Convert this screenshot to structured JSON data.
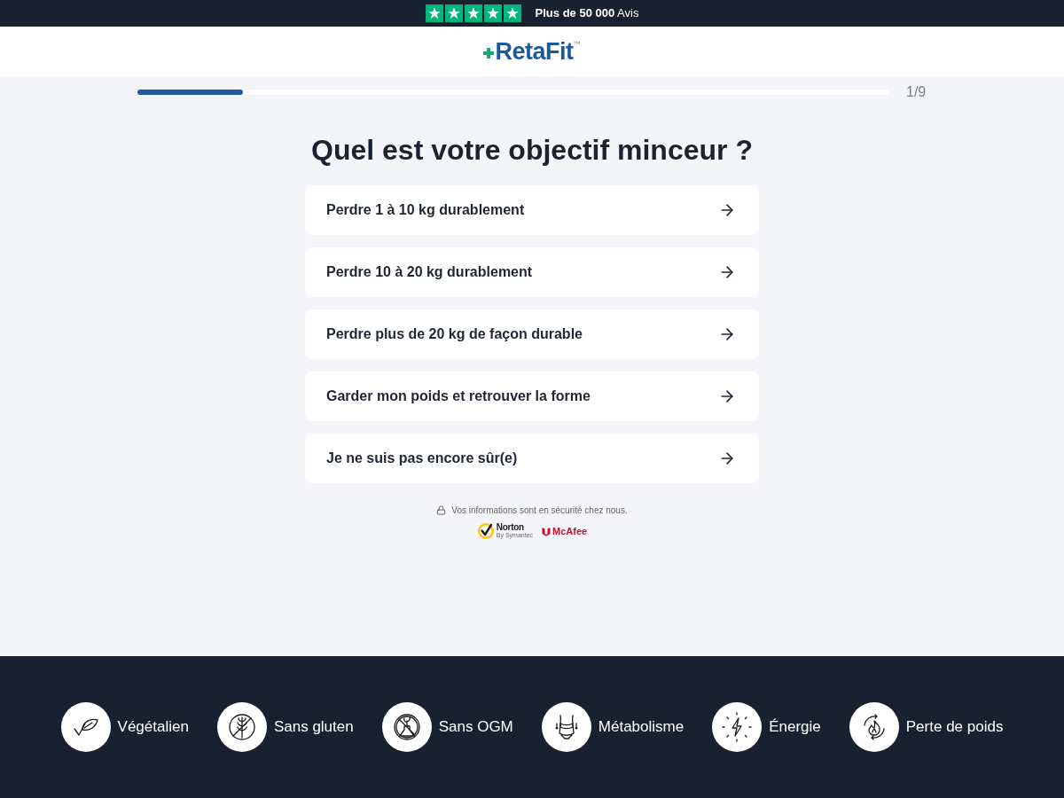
{
  "rating": {
    "stars": 5,
    "text": "**Plus de 50 000** Avis"
  },
  "header": {
    "logo": "RetaFit",
    "trademark": "™"
  },
  "progress": {
    "level": 0.14,
    "label": "1/9"
  },
  "question": "Quel est votre objectif minceur ?",
  "options": [
    {
      "label": "Perdre 1 à 10 kg durablement"
    },
    {
      "label": "Perdre 10 à 20 kg durablement"
    },
    {
      "label": "Perdre plus de 20 kg de façon durable"
    },
    {
      "label": "Garder mon poids et retrouver la forme"
    },
    {
      "label": "Je ne suis pas encore sûr(e)"
    }
  ],
  "security": {
    "text": "Vos informations sont en sécurité chez nous.",
    "badges": [
      {
        "kind": "norton",
        "name": "Norton",
        "subtitle": "By Symantec"
      },
      {
        "kind": "mcafee",
        "name": "McAfee"
      }
    ]
  },
  "benefits": [
    {
      "kind": "vegan",
      "label": "Végétalien"
    },
    {
      "kind": "gluten_free",
      "label": "Sans gluten"
    },
    {
      "kind": "non_gmo",
      "label": "Sans OGM"
    },
    {
      "kind": "metabolism",
      "label": "Métabolisme"
    },
    {
      "kind": "energy",
      "label": "Énergie"
    },
    {
      "kind": "weight_loss",
      "label": "Perte de poids"
    }
  ]
}
